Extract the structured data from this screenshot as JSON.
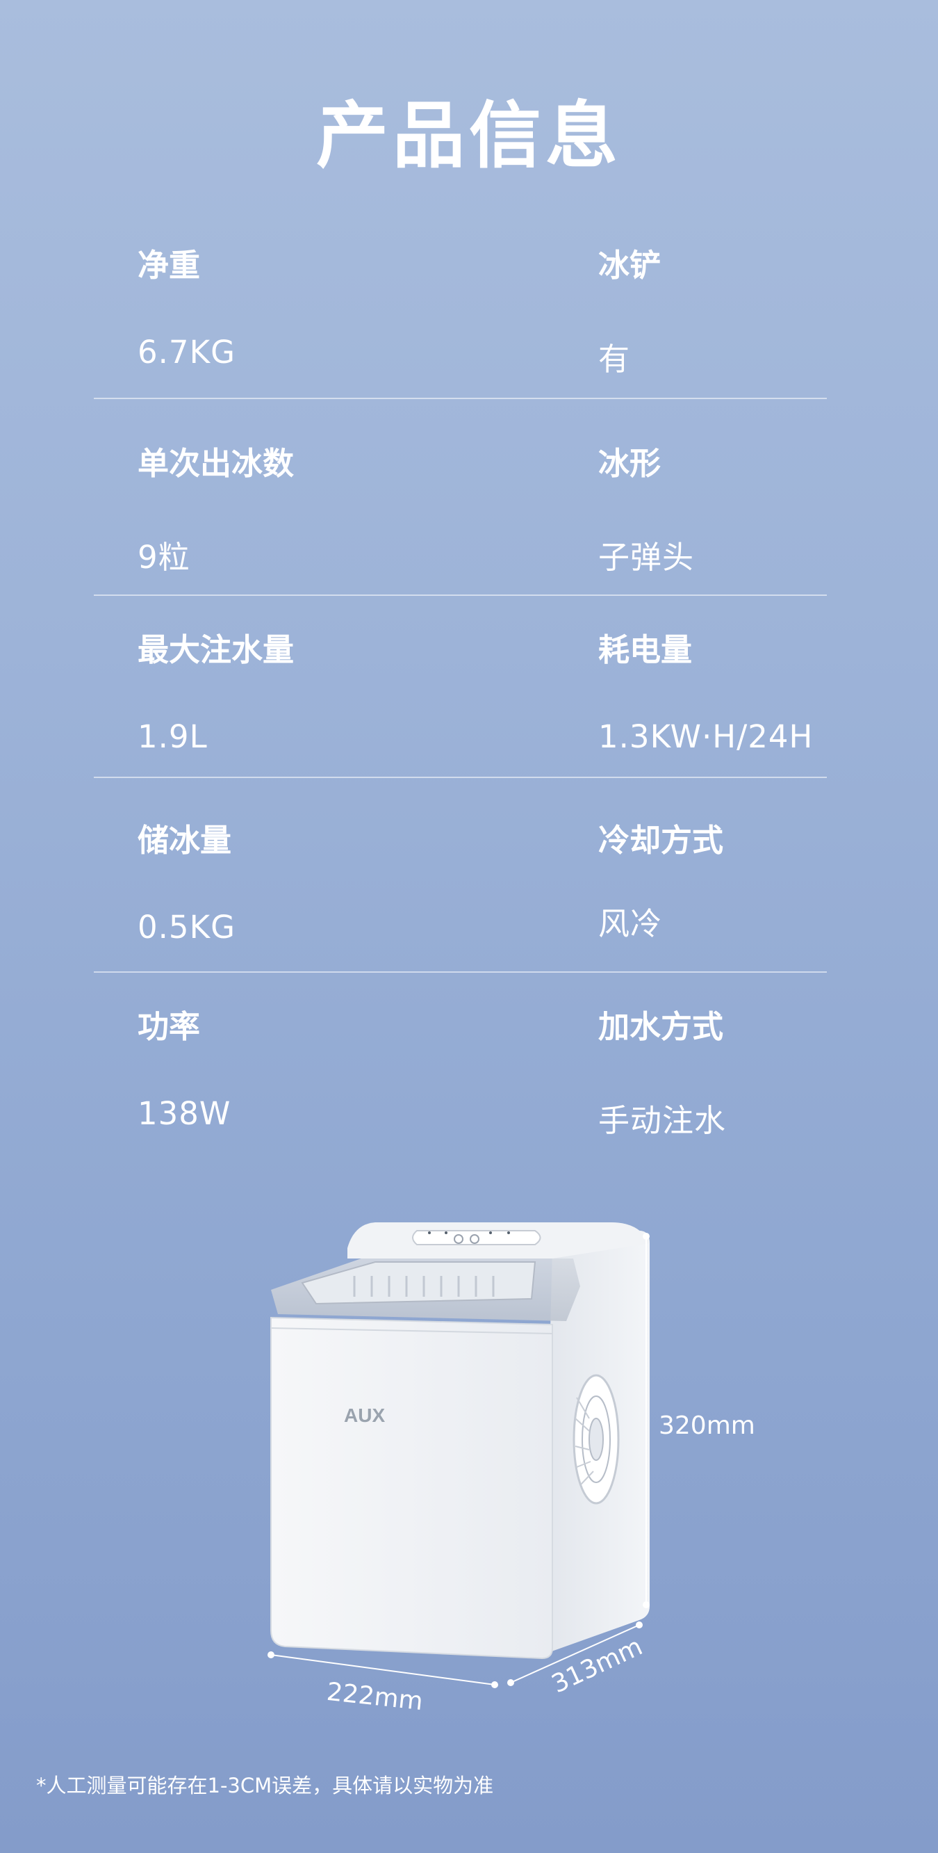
{
  "title": "产品信息",
  "specs": [
    {
      "left": {
        "label": "净重",
        "value": "6.7KG"
      },
      "right": {
        "label": "冰铲",
        "value": "有"
      }
    },
    {
      "left": {
        "label": "单次出冰数",
        "value": "9粒"
      },
      "right": {
        "label": "冰形",
        "value": "子弹头"
      }
    },
    {
      "left": {
        "label": "最大注水量",
        "value": "1.9L"
      },
      "right": {
        "label": "耗电量",
        "value": "1.3KW·H/24H"
      }
    },
    {
      "left": {
        "label": "储冰量",
        "value": "0.5KG"
      },
      "right": {
        "label": "冷却方式",
        "value": "风冷"
      }
    },
    {
      "left": {
        "label": "功率",
        "value": "138W"
      },
      "right": {
        "label": "加水方式",
        "value": "手动注水"
      }
    }
  ],
  "product": {
    "brand_logo": "AUX",
    "height_label": "320mm",
    "width_label": "222mm",
    "depth_label": "313mm"
  },
  "footnote": "*人工测量可能存在1-3CM误差，具体请以实物为准"
}
